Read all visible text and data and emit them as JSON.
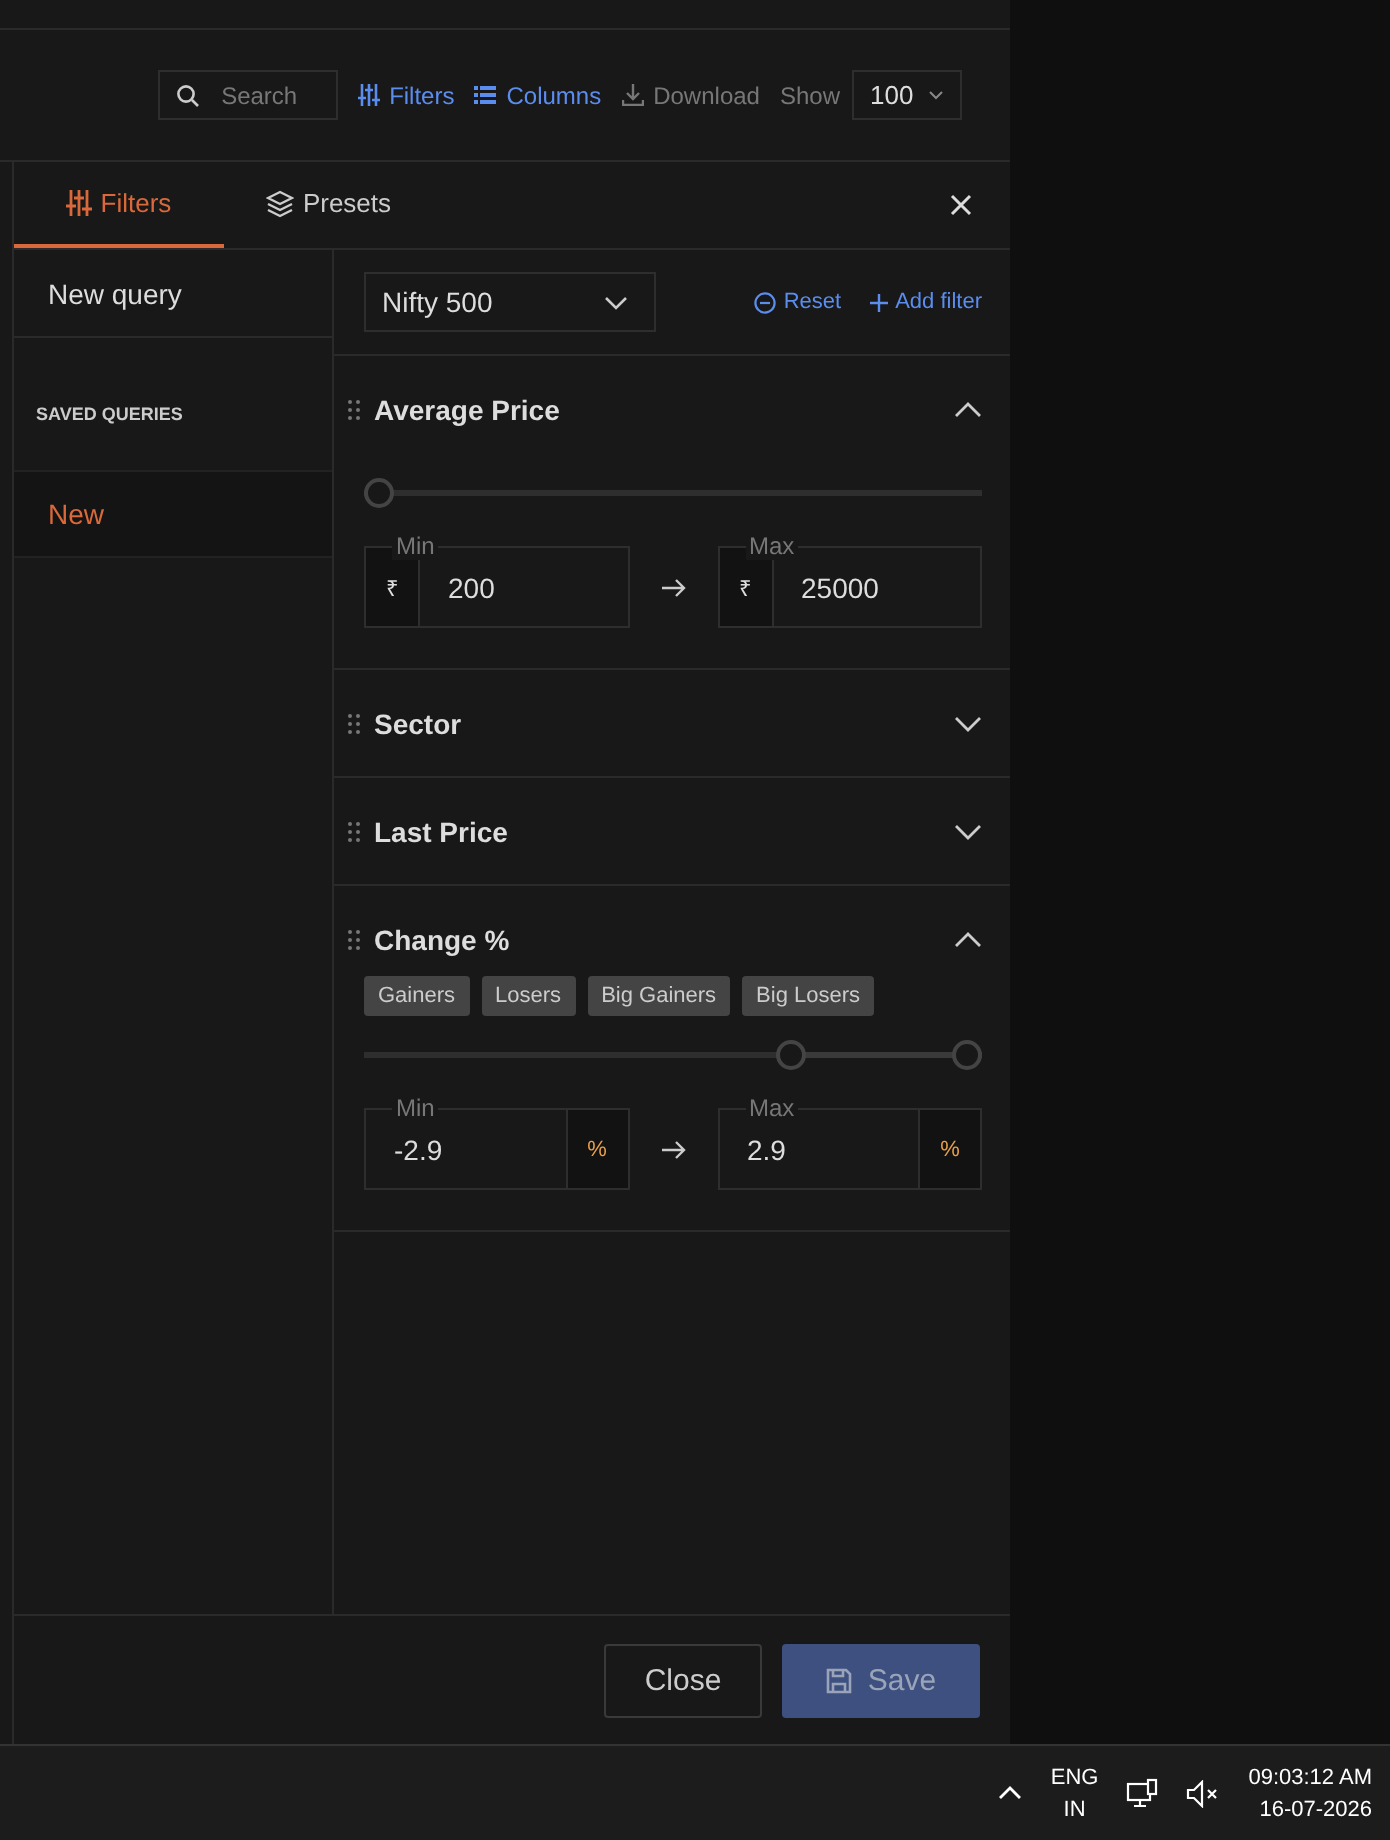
{
  "toolbar": {
    "search": {
      "placeholder": "Search"
    },
    "links": [
      {
        "label": "Filters",
        "kind": "filters",
        "enabled": true
      },
      {
        "label": "Columns",
        "kind": "columns",
        "enabled": true
      },
      {
        "label": "Download",
        "kind": "download",
        "enabled": false
      }
    ],
    "show_label": "Show",
    "show_value": "100"
  },
  "drawer": {
    "tabs": [
      {
        "label": "Filters",
        "kind": "filters",
        "selected": true
      },
      {
        "label": "Presets",
        "kind": "presets",
        "selected": false
      }
    ],
    "sidebar": {
      "new_query": "New query",
      "section": "SAVED QUERIES",
      "items": [
        {
          "label": "New",
          "selected": true
        }
      ]
    },
    "universe": "Nifty 500",
    "reset": "Reset",
    "add_filter": "Add filter",
    "filters": [
      {
        "title": "Average Price",
        "expanded": true,
        "thumbs": [
          {
            "level": 0
          }
        ],
        "prefix": "₹",
        "min_label": "Min",
        "min_value": "200",
        "max_label": "Max",
        "max_value": "25000"
      },
      {
        "title": "Sector",
        "expanded": false
      },
      {
        "title": "Last Price",
        "expanded": false
      },
      {
        "title": "Change %",
        "expanded": true,
        "chips": [
          "Gainers",
          "Losers",
          "Big Gainers",
          "Big Losers"
        ],
        "thumbs": [
          {
            "level": 0.7
          },
          {
            "level": 1
          }
        ],
        "suffix": "%",
        "min_label": "Min",
        "min_value": "-2.9",
        "max_label": "Max",
        "max_value": "2.9"
      }
    ],
    "buttons": [
      {
        "label": "Close",
        "kind": "secondary"
      },
      {
        "label": "Save",
        "kind": "primary"
      }
    ]
  },
  "taskbar": {
    "language": "ENG",
    "region": "IN",
    "time": "09:03:12 AM",
    "date": "16-07-2026",
    "muted": true
  }
}
